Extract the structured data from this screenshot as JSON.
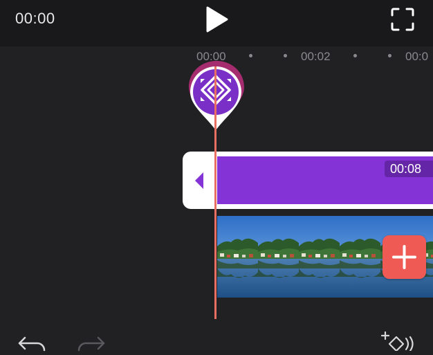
{
  "player": {
    "current_time": "00:00",
    "play_icon": "play-icon",
    "fullscreen_icon": "fullscreen-icon"
  },
  "ruler": {
    "labels": [
      "00:00",
      "00:02",
      "00:0"
    ]
  },
  "keyframe_marker": {
    "icon": "keyframe-diamond-icon",
    "color": "#7a2fc7",
    "ring_color": "#a52d6f"
  },
  "clip": {
    "duration": "00:08",
    "color": "#8433d6",
    "handle_icon": "chevron-left-icon"
  },
  "video_track": {
    "add_button_icon": "plus-icon",
    "add_button_color": "#f05a55"
  },
  "playhead": {
    "color": "#e96f62"
  },
  "bottom_toolbar": {
    "undo_icon": "undo-icon",
    "redo_icon": "redo-icon",
    "add_keyframe_icon": "add-keyframe-icon"
  }
}
